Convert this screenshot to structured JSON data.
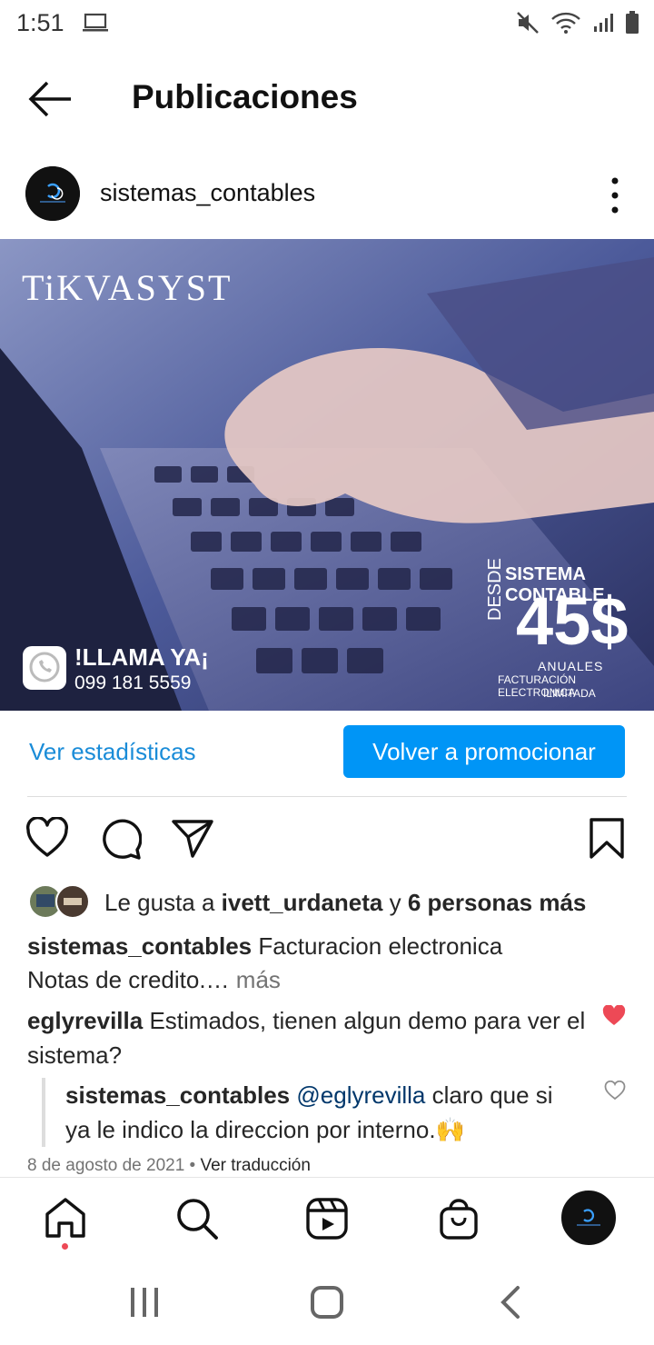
{
  "status_bar": {
    "time": "1:51"
  },
  "header": {
    "title": "Publicaciones"
  },
  "post": {
    "author": "sistemas_contables",
    "image": {
      "brand": "TiKVASYST",
      "call_label": "!LLAMA YA¡",
      "phone": "099 181 5559",
      "headline": "SISTEMA CONTABLE",
      "from_label": "DESDE",
      "price": "45$",
      "period": "ANUALES",
      "feature_line1": "FACTURACIÓN ELECTRONICA",
      "feature_line2": "ILIMITADA"
    },
    "stats_link": "Ver estadísticas",
    "promote_button": "Volver a promocionar",
    "likes": {
      "prefix": "Le gusta a ",
      "user": "ivett_urdaneta",
      "joiner": " y ",
      "others": "6 personas más"
    },
    "caption": {
      "user": "sistemas_contables",
      "line1": "Facturacion electronica",
      "line2": "Notas de credito.…",
      "more": "más"
    },
    "comments": [
      {
        "user": "eglyrevilla",
        "text": "Estimados, tienen algun demo para ver el sistema?"
      }
    ],
    "reply": {
      "user": "sistemas_contables",
      "mention": "@eglyrevilla",
      "text": "claro que si ya le indico la direccion por interno.🙌"
    },
    "date": "8 de agosto de 2021",
    "separator": "•",
    "translate": "Ver traducción"
  },
  "colors": {
    "accent": "#0095f6",
    "link": "#1a8cd8",
    "like_red": "#ed4956"
  }
}
